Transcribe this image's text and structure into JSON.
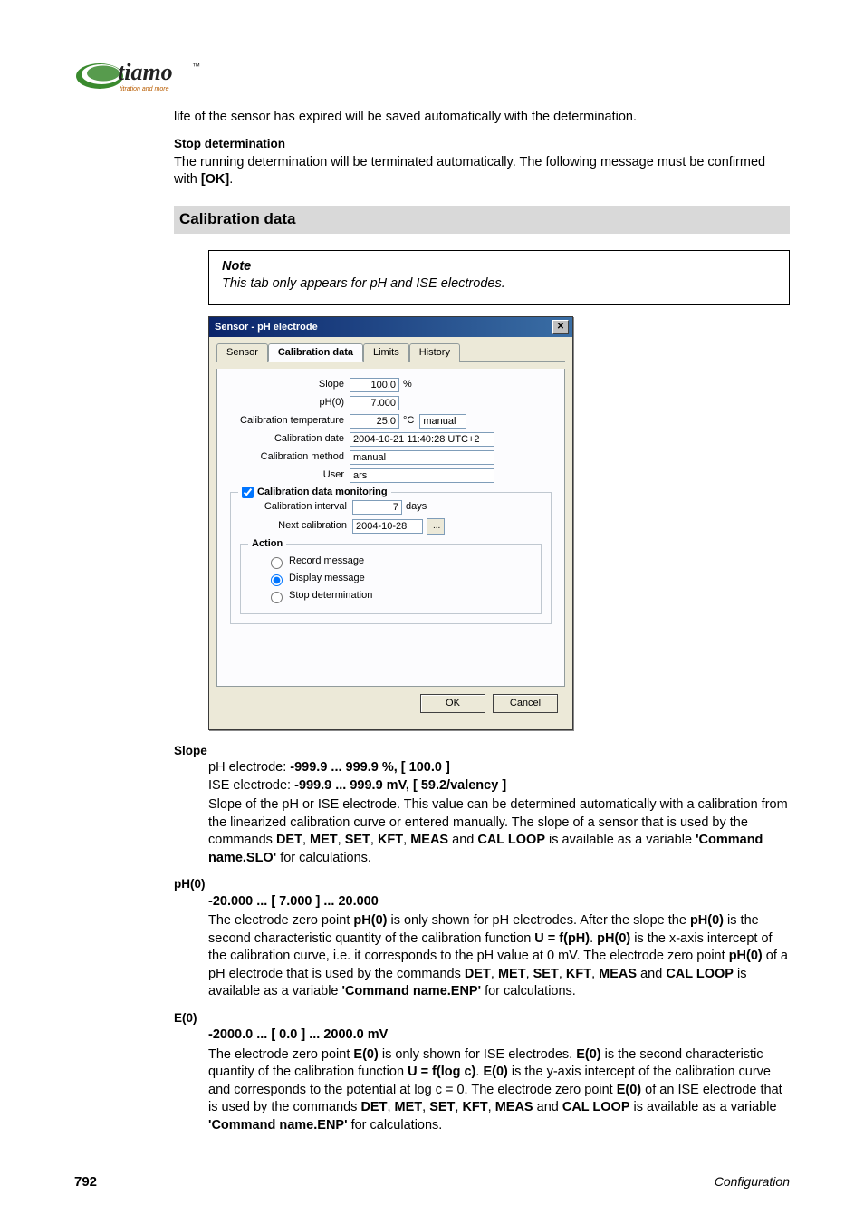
{
  "logo": {
    "brand": "tiamo",
    "tagline": "titration and more",
    "tm": "™"
  },
  "body1": "life of the sensor has expired will be saved automatically with the determination.",
  "stopDet": {
    "title": "Stop determination",
    "text1": "The running determination will be terminated automatically. The following message must be confirmed with ",
    "ok": "[OK]",
    "text2": "."
  },
  "sectionTitle": "Calibration data",
  "note": {
    "title": "Note",
    "text": "This tab only appears for pH and ISE electrodes."
  },
  "dialog": {
    "title": "Sensor - pH electrode",
    "tabs": {
      "sensor": "Sensor",
      "calib": "Calibration data",
      "limits": "Limits",
      "history": "History"
    },
    "labels": {
      "slope": "Slope",
      "ph0": "pH(0)",
      "caltemp": "Calibration temperature",
      "caldate": "Calibration date",
      "calmethod": "Calibration method",
      "user": "User",
      "monitoring": "Calibration data monitoring",
      "interval": "Calibration interval",
      "next": "Next calibration",
      "action": "Action",
      "record": "Record message",
      "display": "Display message",
      "stop": "Stop determination"
    },
    "values": {
      "slope": "100.0",
      "slope_unit": "%",
      "ph0": "7.000",
      "caltemp": "25.0",
      "caltemp_unit": "°C",
      "caltemp_mode": "manual",
      "caldate": "2004-10-21 11:40:28 UTC+2",
      "calmethod": "manual",
      "user": "ars",
      "interval": "7",
      "interval_unit": "days",
      "next": "2004-10-28"
    },
    "buttons": {
      "ok": "OK",
      "cancel": "Cancel",
      "more": "..."
    }
  },
  "slope": {
    "title": "Slope",
    "l1a": "pH electrode: ",
    "l1b": "-999.9 ... 999.9 %, [ 100.0 ]",
    "l2a": "ISE electrode: ",
    "l2b": "-999.9 ... 999.9 mV, [ 59.2/valency ]",
    "p1": "Slope of the pH or ISE electrode. This value can be determined automatically with a calibration from the linearized calibration curve or entered manually. The slope of a sensor that is used by the commands ",
    "c": {
      "det": "DET",
      "met": "MET",
      "set": "SET",
      "kft": "KFT",
      "meas": "MEAS",
      "cal": "CAL LOOP"
    },
    "p2": " is available as a variable ",
    "var": "'Command name.SLO'",
    "p3": " for calculations."
  },
  "ph0": {
    "title": "pH(0)",
    "range": "-20.000 ... [ 7.000 ] ... 20.000",
    "t1": "The electrode zero point ",
    "b1": "pH(0)",
    "t2": " is only shown for pH electrodes. After the slope the ",
    "b2": "pH(0)",
    "t3": " is the second characteristic quantity of the calibration function ",
    "b3": "U = f(pH)",
    "t4": ". ",
    "b4": "pH(0)",
    "t5": " is the x-axis intercept of the calibration curve, i.e. it corresponds to the pH value at 0 mV. The electrode zero point ",
    "b5": "pH(0)",
    "t6": " of a pH electrode that is used by the commands ",
    "t7": " is available as a variable ",
    "var": "'Command name.ENP'",
    "t8": " for calculations."
  },
  "e0": {
    "title": "E(0)",
    "range": "-2000.0 ... [ 0.0 ] ... 2000.0 mV",
    "t1": "The electrode zero point ",
    "b1": "E(0)",
    "t2": " is only shown for ISE electrodes. ",
    "b2": "E(0)",
    "t3": " is the second characteristic quantity of the calibration function ",
    "b3": "U = f(log c)",
    "t4": ". ",
    "b4": "E(0)",
    "t5": " is the y-axis intercept of the calibration curve and corresponds to the potential at log c = 0. The electrode zero point ",
    "b5": "E(0)",
    "t6": " of an ISE electrode that is used by the commands ",
    "t7": " is available as a variable ",
    "var": "'Command name.ENP'",
    "t8": " for calculations."
  },
  "sep": {
    "comma": ", ",
    "and": " and "
  },
  "footer": {
    "page": "792",
    "section": "Configuration"
  }
}
